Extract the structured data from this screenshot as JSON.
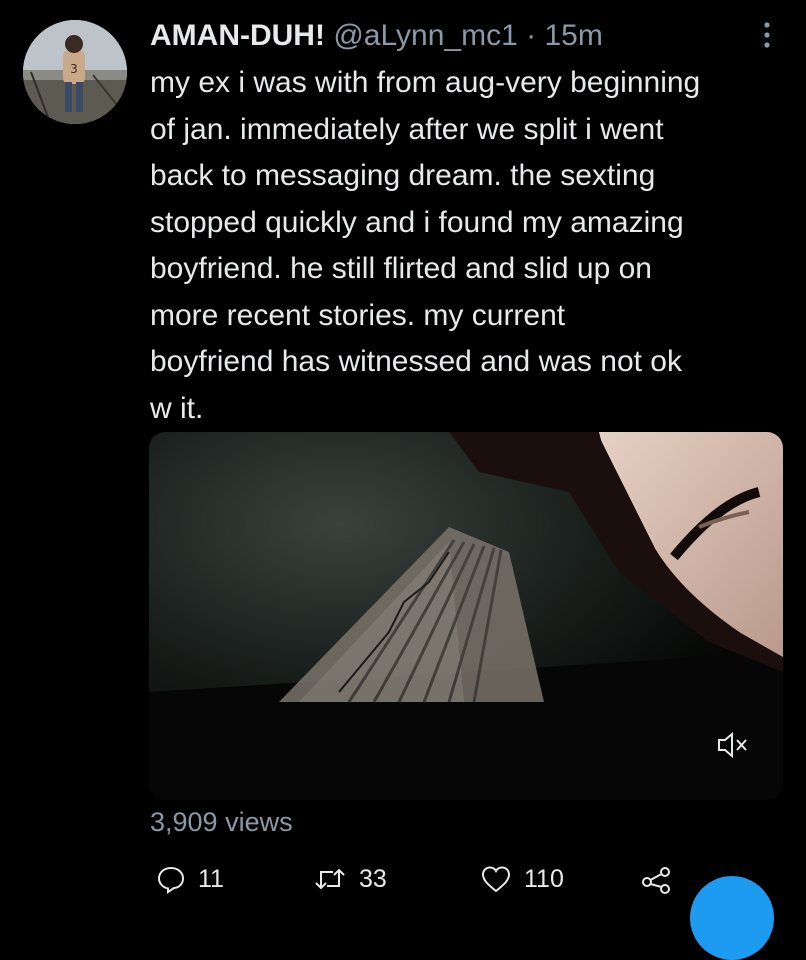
{
  "tweet": {
    "author": {
      "display_name": "AMAN-DUH!",
      "handle": "@aLynn_mc1",
      "avatar_icon": "profile-photo"
    },
    "separator": "·",
    "time": "15m",
    "text": "my ex i was with from aug-very beginning\nof jan. immediately after we split i went\nback to messaging dream. the sexting\nstopped quickly and i found my amazing\nboyfriend. he still flirted and slid up on\nmore recent stories. my current\nboyfriend has witnessed and was not ok\nw it.",
    "media": {
      "type": "video",
      "mute_icon": "speaker-muted-icon"
    },
    "views": "3,909 views",
    "actions": {
      "reply": {
        "icon": "reply-icon",
        "count": "11"
      },
      "retweet": {
        "icon": "retweet-icon",
        "count": "33"
      },
      "like": {
        "icon": "heart-icon",
        "count": "110"
      },
      "share": {
        "icon": "share-icon"
      }
    }
  },
  "colors": {
    "background": "#000000",
    "text_primary": "#e7e9ea",
    "text_secondary": "#8b98a5",
    "accent": "#1d9bf0"
  }
}
